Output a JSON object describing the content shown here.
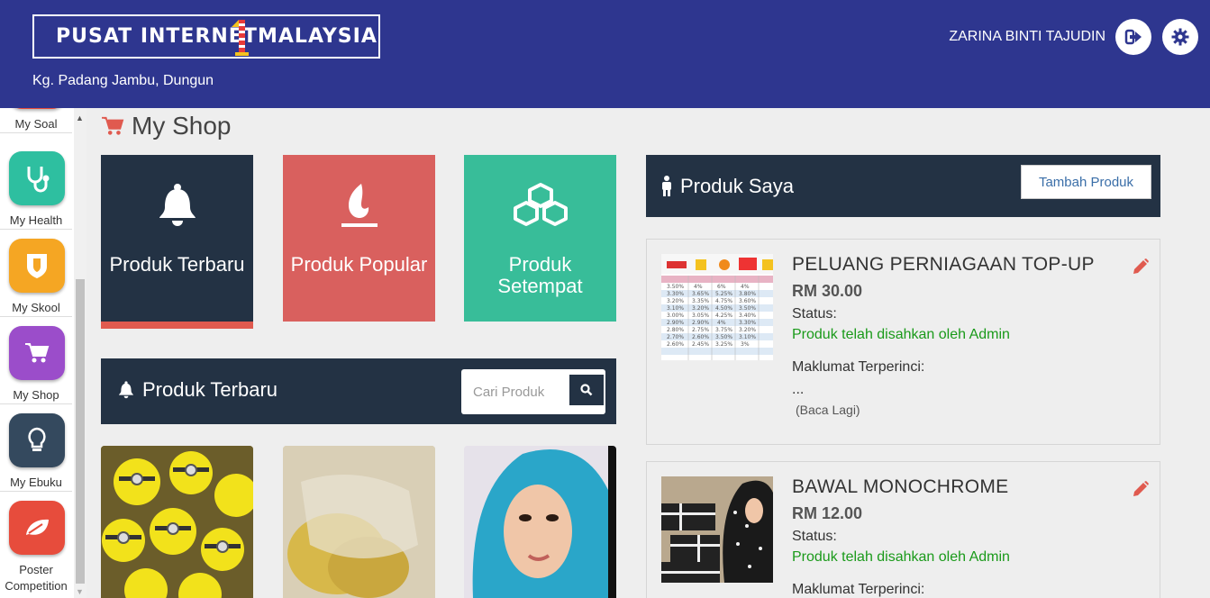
{
  "header": {
    "logo_left": "PUSAT INTERNET",
    "logo_right": "MALAYSIA",
    "location": "Kg. Padang Jambu, Dungun",
    "user_name": "ZARINA BINTI TAJUDIN",
    "logout_icon": "logout-icon",
    "settings_icon": "gear-icon"
  },
  "sidebar": {
    "items": [
      {
        "label": "My Soal",
        "icon": "quiz-icon",
        "color": "#e74c3c"
      },
      {
        "label": "My Health",
        "icon": "stethoscope-icon",
        "color": "#2ebfa0"
      },
      {
        "label": "My Skool",
        "icon": "shield-icon",
        "color": "#f5a623"
      },
      {
        "label": "My Shop",
        "icon": "cart-icon",
        "color": "#9b4dca"
      },
      {
        "label": "My Ebuku",
        "icon": "lightbulb-icon",
        "color": "#34495e"
      },
      {
        "label": "Poster Competition",
        "icon": "leaf-icon",
        "color": "#e74c3c"
      }
    ]
  },
  "page": {
    "title": "My Shop",
    "title_icon": "cart-icon"
  },
  "tiles": [
    {
      "label": "Produk Terbaru",
      "icon": "bell-icon",
      "color": "#233244"
    },
    {
      "label": "Produk Popular",
      "icon": "fire-icon",
      "color": "#d9605e"
    },
    {
      "label": "Produk Setempat",
      "icon": "cubes-icon",
      "color": "#38bd99"
    }
  ],
  "latest": {
    "title": "Produk Terbaru",
    "search_placeholder": "Cari Produk"
  },
  "my_products": {
    "title": "Produk Saya",
    "add_label": "Tambah Produk",
    "items": [
      {
        "name": "PELUANG PERNIAGAAN TOP-UP",
        "price": "RM 30.00",
        "status_label": "Status:",
        "status": "Produk telah disahkan oleh Admin",
        "detail_label": "Maklumat Terperinci:",
        "detail": "...",
        "more": "(Baca Lagi)"
      },
      {
        "name": "BAWAL MONOCHROME",
        "price": "RM 12.00",
        "status_label": "Status:",
        "status": "Produk telah disahkan oleh Admin",
        "detail_label": "Maklumat Terperinci:"
      }
    ]
  },
  "colors": {
    "header": "#2e368f",
    "panel": "#233244",
    "approved": "#1a9a1a",
    "edit": "#e05a4f"
  }
}
